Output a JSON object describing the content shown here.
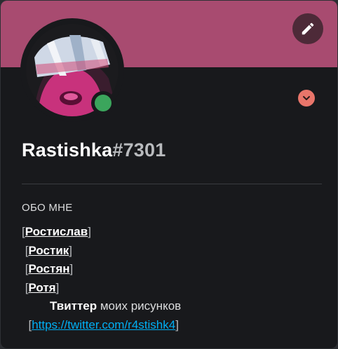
{
  "profile": {
    "name": "Rastishka",
    "discriminator": "#7301",
    "status": "online",
    "status_color": "#3ba55c",
    "banner_color": "#a84b70",
    "avatar_icon": "avatar-image"
  },
  "actions": {
    "edit_icon": "pencil-icon",
    "expand_icon": "chevron-down-icon"
  },
  "about": {
    "title": "ОБО МНЕ",
    "names": [
      "Ростислав",
      "Ростик",
      "Ростян",
      "Ротя"
    ],
    "twitter_bold": "Твиттер",
    "twitter_text": " моих рисунков",
    "twitter_link": "https://twitter.com/r4stishk4"
  }
}
